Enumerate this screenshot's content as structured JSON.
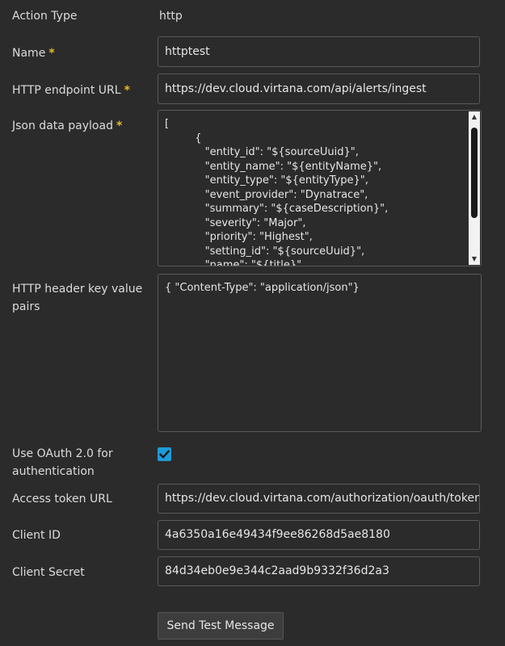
{
  "action_type": {
    "label": "Action Type",
    "value": "http"
  },
  "name": {
    "label": "Name",
    "required_mark": "*",
    "value": "httptest"
  },
  "endpoint": {
    "label": "HTTP endpoint URL",
    "required_mark": "*",
    "value": "https://dev.cloud.virtana.com/api/alerts/ingest"
  },
  "payload": {
    "label": "Json data payload",
    "required_mark": "*",
    "value": "[\n         {\n            \"entity_id\": \"${sourceUuid}\",\n            \"entity_name\": \"${entityName}\",\n            \"entity_type\": \"${entityType}\",\n            \"event_provider\": \"Dynatrace\",\n            \"summary\": \"${caseDescription}\",\n            \"severity\": \"Major\",\n            \"priority\": \"Highest\",\n            \"setting_id\": \"${sourceUuid}\",\n            \"name\": \"${title}\","
  },
  "headers": {
    "label": "HTTP header key value pairs",
    "value": "{ \"Content-Type\": \"application/json\"}"
  },
  "oauth": {
    "label": "Use OAuth 2.0 for authentication",
    "checked": true
  },
  "access_token": {
    "label": "Access token URL",
    "value": "https://dev.cloud.virtana.com/authorization/oauth/token"
  },
  "client_id": {
    "label": "Client ID",
    "value": "4a6350a16e49434f9ee86268d5ae8180"
  },
  "client_secret": {
    "label": "Client Secret",
    "value": "84d34eb0e9e344c2aad9b9332f36d2a3"
  },
  "send_button": {
    "label": "Send Test Message"
  },
  "colors": {
    "background": "#2b2b2b",
    "required": "#e8b923",
    "checkbox": "#1e9bd7"
  }
}
